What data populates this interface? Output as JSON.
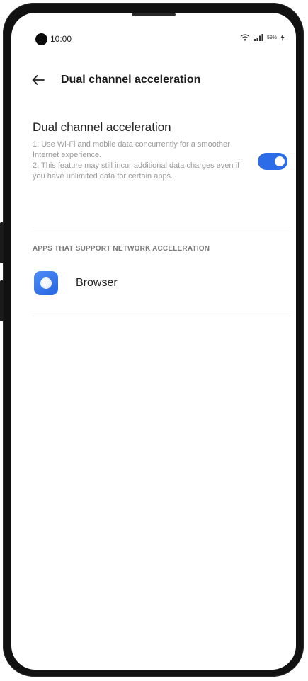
{
  "status_bar": {
    "time": "10:00",
    "battery": "59%",
    "icons": [
      "wifi-icon",
      "signal-icon",
      "battery-charging-icon"
    ]
  },
  "header": {
    "title": "Dual channel acceleration",
    "back_icon": "arrow-left-icon"
  },
  "setting": {
    "title": "Dual channel acceleration",
    "description_1": "1. Use Wi-Fi and mobile data concurrently for a smoother Internet experience.",
    "description_2": "2. This feature may still incur additional data charges even if you have unlimited data for certain apps.",
    "enabled": true
  },
  "apps_section": {
    "header": "APPS THAT SUPPORT NETWORK ACCELERATION",
    "apps": [
      {
        "label": "Browser",
        "icon": "browser-icon"
      }
    ]
  },
  "colors": {
    "accent": "#2c6ce6",
    "text_primary": "#222222",
    "text_secondary": "#9a9a9a"
  }
}
